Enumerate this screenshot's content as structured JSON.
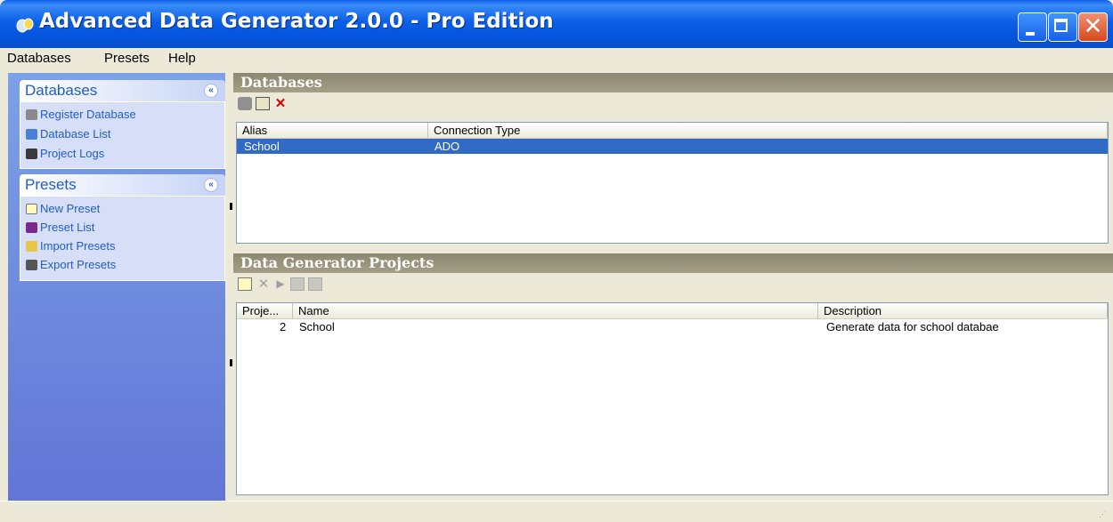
{
  "window": {
    "title": "Advanced Data Generator 2.0.0 - Pro Edition",
    "minimize_icon": "minimize-icon",
    "maximize_icon": "maximize-icon",
    "close_label": "✕"
  },
  "menu": [
    "Databases",
    "Presets",
    "Help"
  ],
  "sidebar": {
    "databases_panel": {
      "title": "Databases",
      "collapse_glyph": "«",
      "items": [
        {
          "label": "Register Database",
          "icon": "register-database-icon"
        },
        {
          "label": "Database List",
          "icon": "database-list-icon"
        },
        {
          "label": "Project Logs",
          "icon": "project-logs-icon"
        }
      ]
    },
    "presets_panel": {
      "title": "Presets",
      "collapse_glyph": "«",
      "items": [
        {
          "label": "New Preset",
          "icon": "new-preset-icon"
        },
        {
          "label": "Preset List",
          "icon": "preset-list-icon"
        },
        {
          "label": "Import Presets",
          "icon": "import-presets-icon"
        },
        {
          "label": "Export Presets",
          "icon": "export-presets-icon"
        }
      ]
    }
  },
  "databases": {
    "title": "Databases",
    "toolbar": [
      "register-icon",
      "edit-icon",
      "delete-icon"
    ],
    "delete_glyph": "✕",
    "columns": [
      "Alias",
      "Connection Type"
    ],
    "rows": [
      {
        "alias": "School",
        "connection_type": "ADO",
        "selected": true
      }
    ]
  },
  "projects": {
    "title": "Data Generator Projects",
    "toolbar": [
      "new-icon",
      "delete-icon",
      "run-icon",
      "edit-icon",
      "copy-icon"
    ],
    "delete_glyph": "✕",
    "run_glyph": "▶",
    "columns": [
      "Proje...",
      "Name",
      "Description"
    ],
    "rows": [
      {
        "id": "2",
        "name": "School",
        "description": "Generate data for school databae"
      }
    ]
  },
  "colors": {
    "titlebar": "#0453dc",
    "sidebar": "#6375d6",
    "section_header": "#a59f86",
    "selection": "#316ac5",
    "link": "#215dc6"
  }
}
